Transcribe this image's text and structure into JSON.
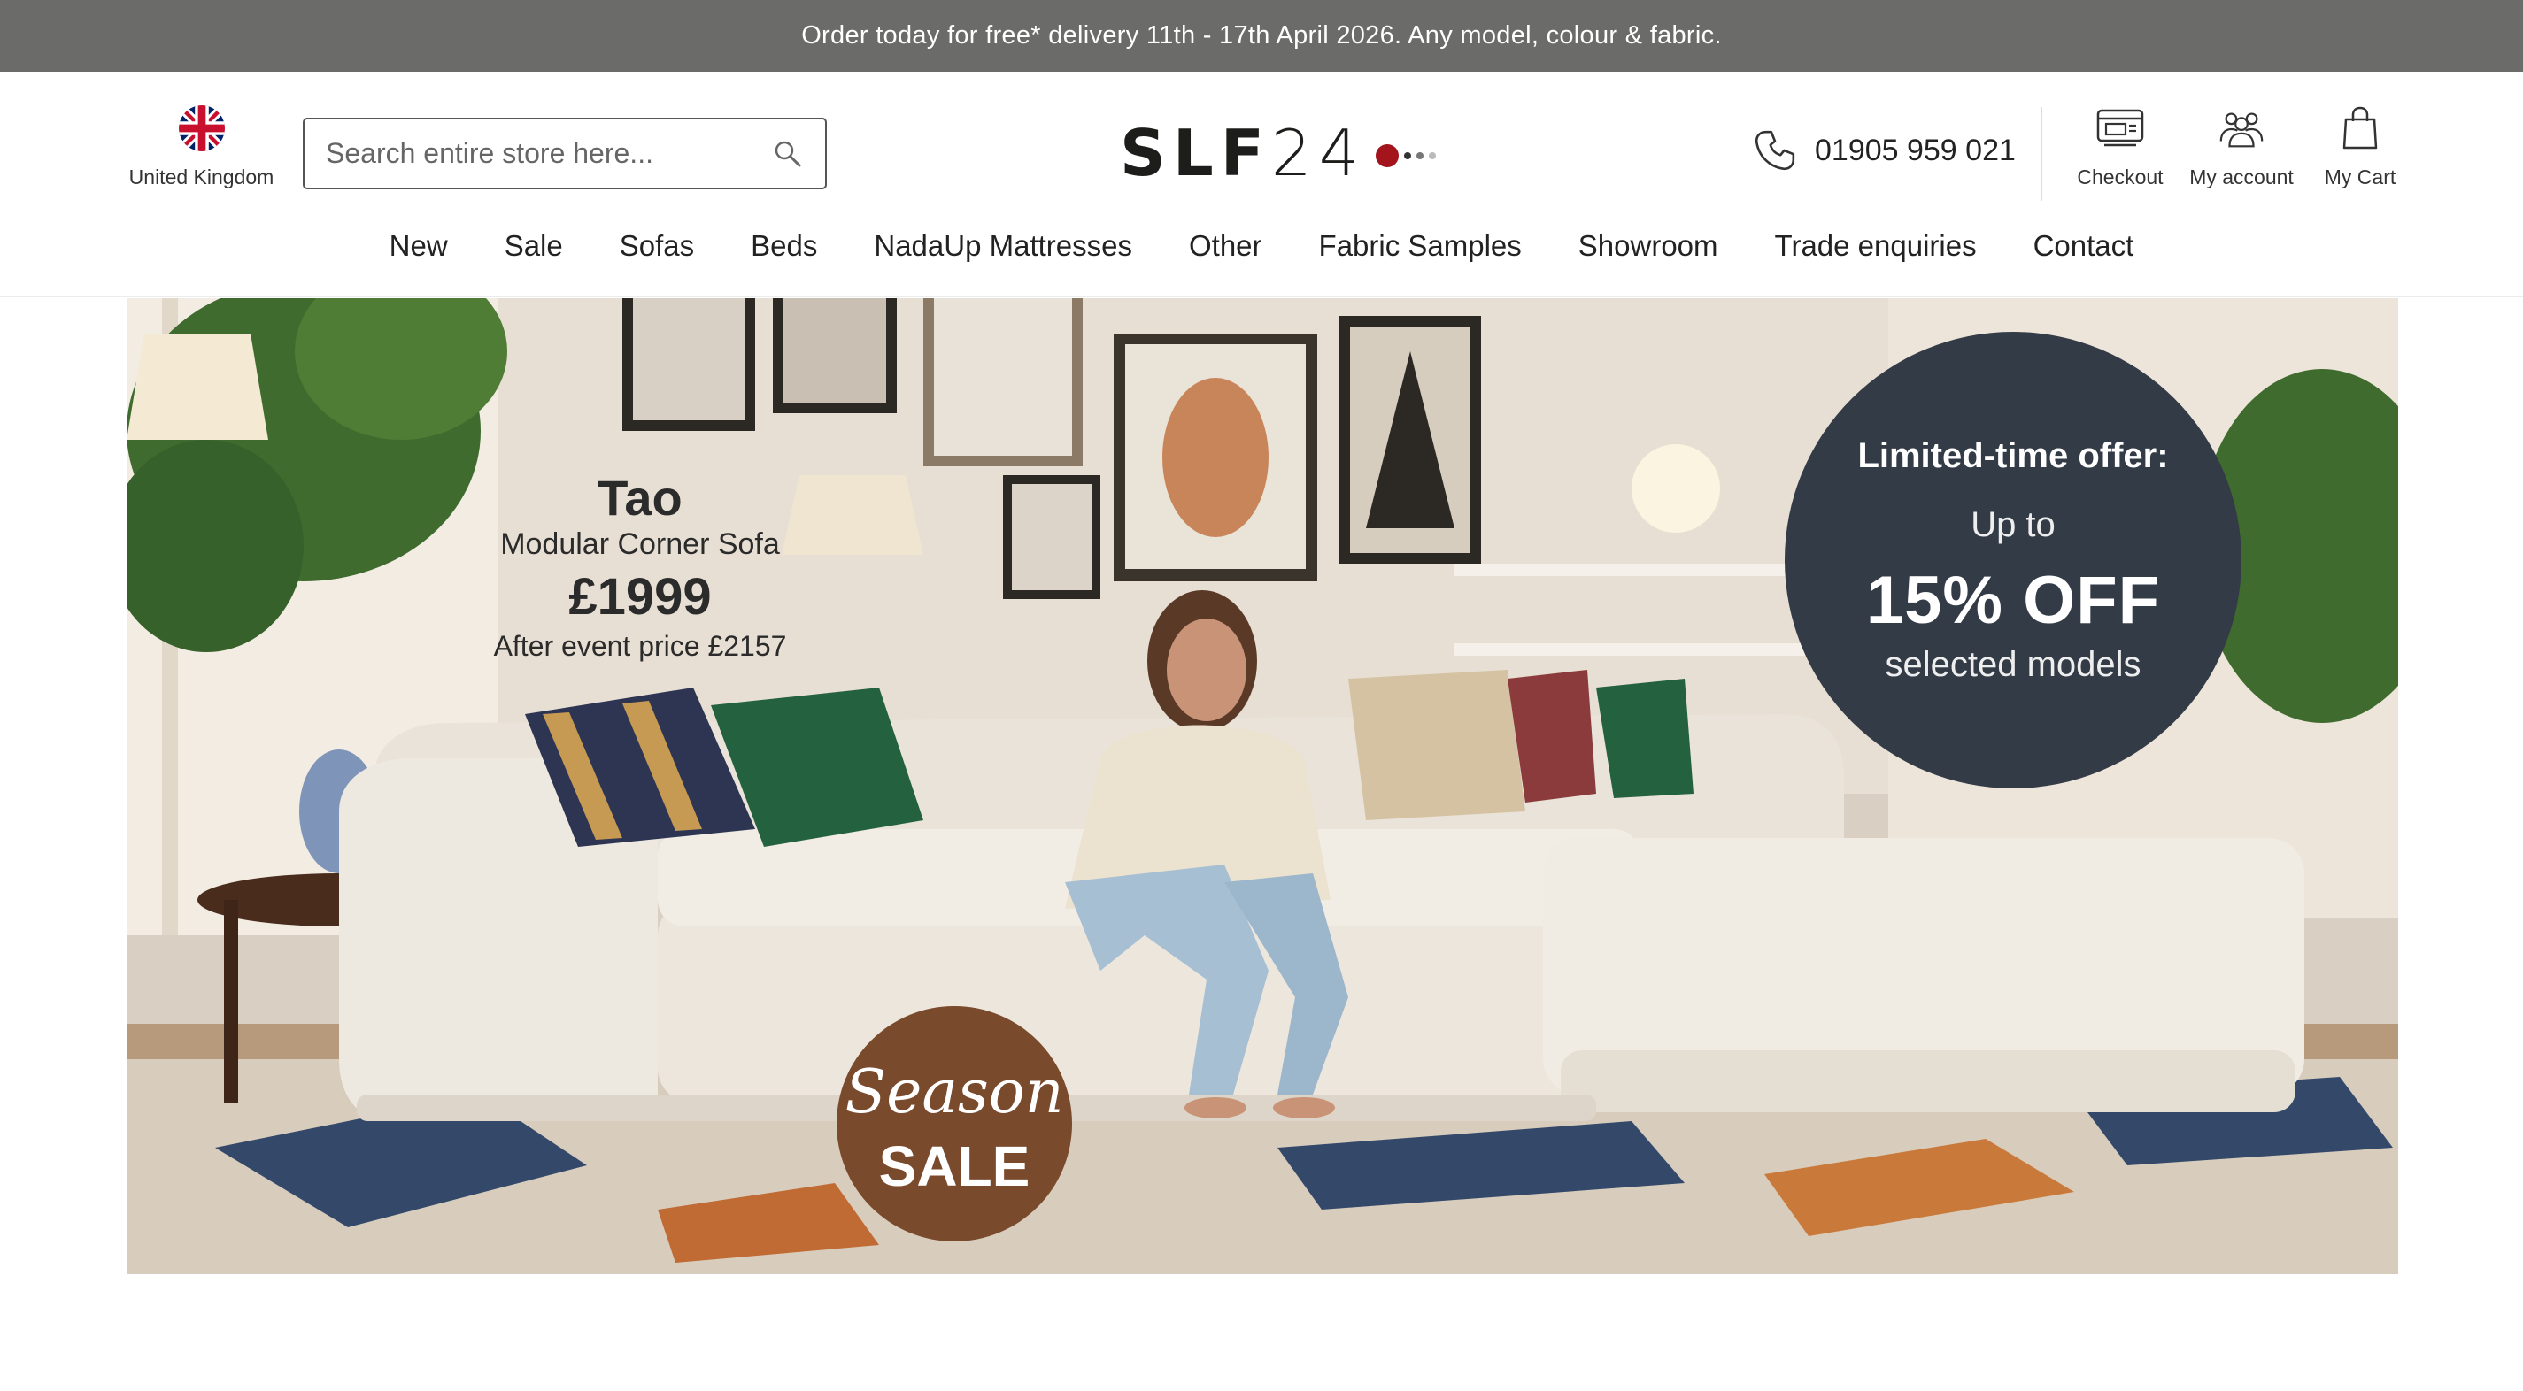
{
  "promo": {
    "text": "Order today for free* delivery 11th - 17th April 2026.  Any model, colour & fabric."
  },
  "header": {
    "country": {
      "label": "United Kingdom",
      "icon": "uk-flag-icon"
    },
    "search": {
      "placeholder": "Search entire store here...",
      "icon": "search-icon"
    },
    "logo": {
      "text_bold": "SLF",
      "text_light": "24",
      "accent_color": "#a3141c"
    },
    "phone": {
      "number": "01905 959 021",
      "icon": "phone-icon"
    },
    "actions": [
      {
        "label": "Checkout",
        "icon": "checkout-icon"
      },
      {
        "label": "My account",
        "icon": "account-icon"
      },
      {
        "label": "My Cart",
        "icon": "cart-icon"
      }
    ]
  },
  "nav": {
    "items": [
      {
        "label": "New"
      },
      {
        "label": "Sale"
      },
      {
        "label": "Sofas"
      },
      {
        "label": "Beds"
      },
      {
        "label": "NadaUp Mattresses"
      },
      {
        "label": "Other"
      },
      {
        "label": "Fabric Samples"
      },
      {
        "label": "Showroom"
      },
      {
        "label": "Trade enquiries"
      },
      {
        "label": "Contact"
      }
    ]
  },
  "hero": {
    "product": {
      "name": "Tao",
      "type": "Modular Corner Sofa",
      "price": "£1999",
      "after_price": "After event price £2157"
    },
    "offer": {
      "headline": "Limited-time offer:",
      "prefix": "Up to",
      "discount": "15% OFF",
      "suffix": "selected models",
      "color": "#333b47"
    },
    "badge": {
      "line1": "Season",
      "line2": "SALE",
      "color": "#7a4a2c"
    }
  }
}
